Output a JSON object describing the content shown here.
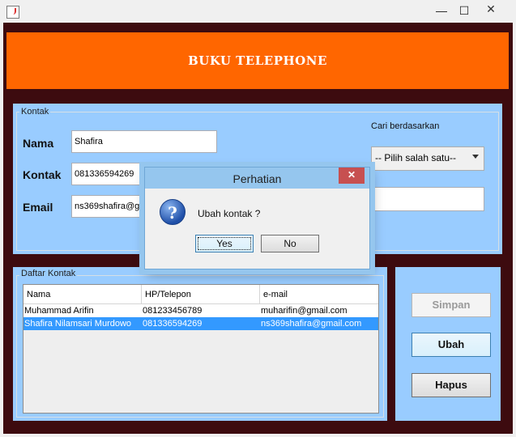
{
  "window": {
    "minimize_glyph": "—",
    "maximize_glyph": "☐",
    "close_glyph": "✕"
  },
  "banner": {
    "title": "BUKU TELEPHONE"
  },
  "kontak": {
    "group_title": "Kontak",
    "nama_label": "Nama",
    "nama_value": "Shafira",
    "kontak_label": "Kontak",
    "kontak_value": "081336594269",
    "email_label": "Email",
    "email_value": "ns369shafira@gmail.com",
    "search_label": "Cari berdasarkan",
    "search_select": "-- Pilih salah satu--",
    "search_value": ""
  },
  "daftar": {
    "group_title": "Daftar Kontak",
    "columns": [
      "Nama",
      "HP/Telepon",
      "e-mail"
    ],
    "rows": [
      [
        "Muhammad Arifin",
        "081233456789",
        "muharifin@gmail.com"
      ],
      [
        "Shafira Nilamsari Murdowo",
        "081336594269",
        "ns369shafira@gmail.com"
      ]
    ],
    "selected_row": 1
  },
  "buttons": {
    "simpan": "Simpan",
    "ubah": "Ubah",
    "hapus": "Hapus"
  },
  "dialog": {
    "title": "Perhatian",
    "icon": "question-icon",
    "icon_glyph": "?",
    "message": "Ubah kontak ?",
    "yes": "Yes",
    "no": "No",
    "close_glyph": "✕"
  },
  "colors": {
    "banner": "#ff6600",
    "frame": "#3d0b0f",
    "panel": "#99ccff",
    "selection": "#3399ff"
  }
}
